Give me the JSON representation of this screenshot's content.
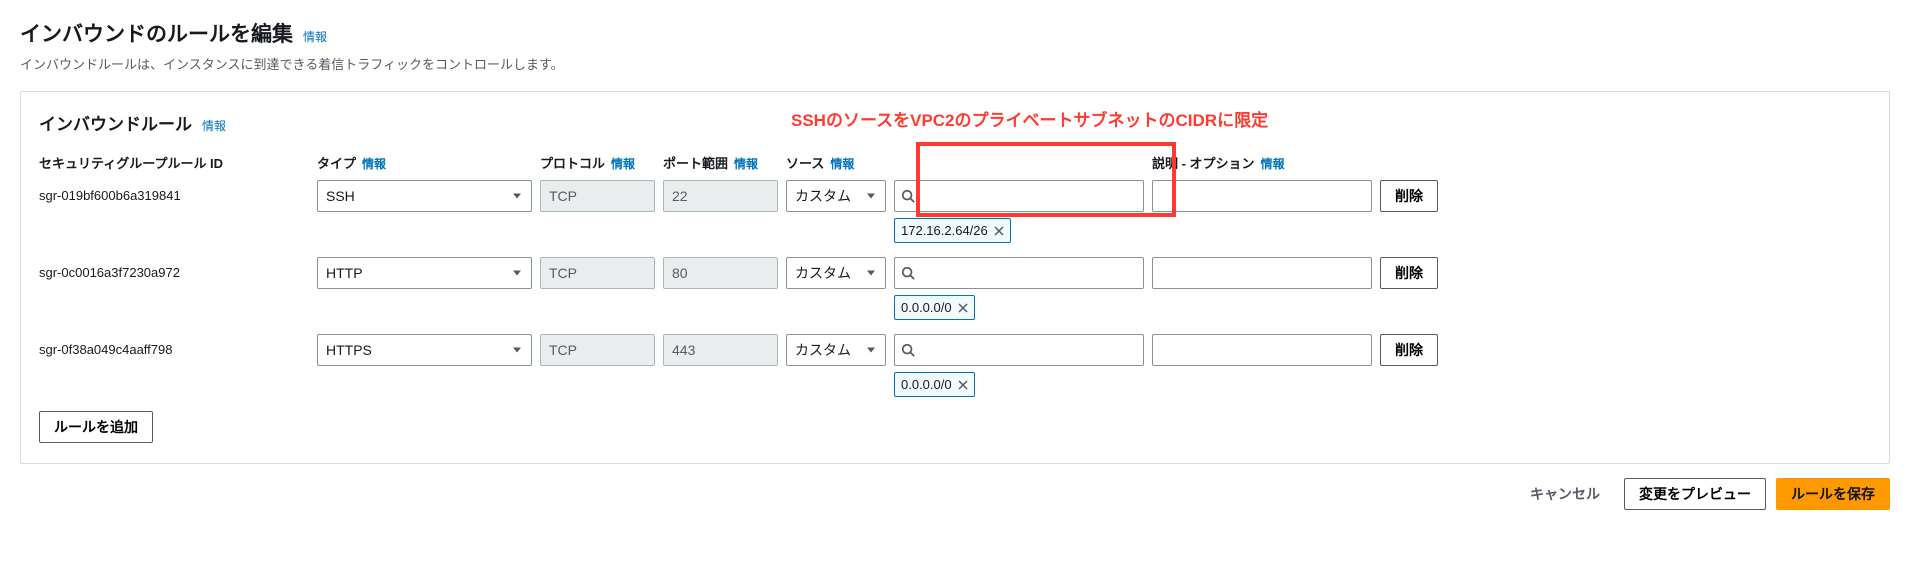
{
  "page": {
    "title": "インバウンドのルールを編集",
    "info_label": "情報",
    "subtitle": "インバウンドルールは、インスタンスに到達できる着信トラフィックをコントロールします。"
  },
  "panel": {
    "title": "インバウンドルール",
    "info_label": "情報",
    "annotation": "SSHのソースをVPC2のプライベートサブネットのCIDRに限定"
  },
  "headers": {
    "rule_id": "セキュリティグループルール ID",
    "type": "タイプ",
    "protocol": "プロトコル",
    "port": "ポート範囲",
    "source": "ソース",
    "description": "説明 - オプション"
  },
  "rules": [
    {
      "id": "sgr-019bf600b6a319841",
      "type": "SSH",
      "protocol": "TCP",
      "port": "22",
      "source_mode": "カスタム",
      "cidrs": [
        "172.16.2.64/26"
      ],
      "description": ""
    },
    {
      "id": "sgr-0c0016a3f7230a972",
      "type": "HTTP",
      "protocol": "TCP",
      "port": "80",
      "source_mode": "カスタム",
      "cidrs": [
        "0.0.0.0/0"
      ],
      "description": ""
    },
    {
      "id": "sgr-0f38a049c4aaff798",
      "type": "HTTPS",
      "protocol": "TCP",
      "port": "443",
      "source_mode": "カスタム",
      "cidrs": [
        "0.0.0.0/0"
      ],
      "description": ""
    }
  ],
  "buttons": {
    "delete": "削除",
    "add_rule": "ルールを追加",
    "cancel": "キャンセル",
    "preview": "変更をプレビュー",
    "save": "ルールを保存"
  }
}
